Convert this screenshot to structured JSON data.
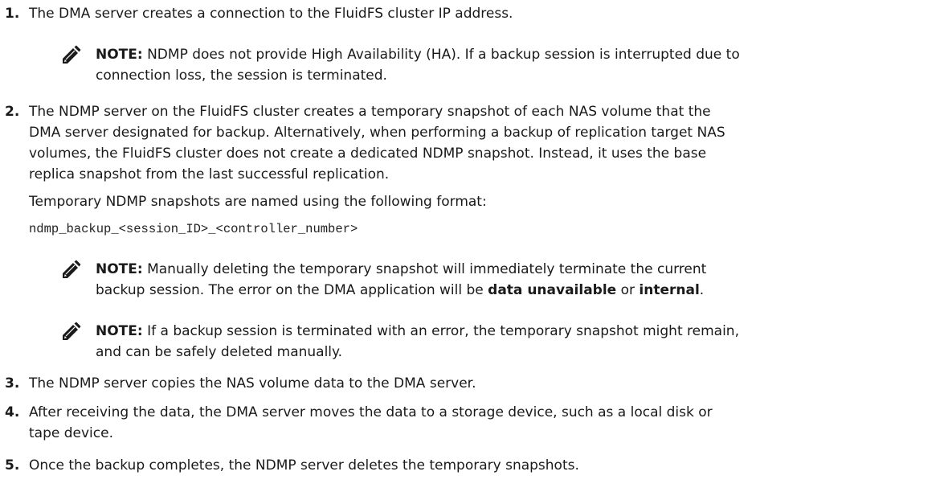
{
  "steps": [
    {
      "num": "1.",
      "text": "The DMA server creates a connection to the FluidFS cluster IP address."
    },
    {
      "num": "2.",
      "text": "The NDMP server on the FluidFS cluster creates a temporary snapshot of each NAS volume that the DMA server designated for backup. Alternatively, when performing a backup of replication target NAS volumes, the FluidFS cluster does not create a dedicated NDMP snapshot. Instead, it uses the base replica snapshot from the last successful replication.",
      "line1": "The NDMP server on the FluidFS cluster creates a temporary snapshot of each NAS volume that the",
      "line2": "DMA server designated for backup. Alternatively, when performing a backup of replication target NAS",
      "line3": "volumes, the FluidFS cluster does not create a dedicated NDMP snapshot. Instead, it uses the base",
      "line4": "replica snapshot from the last successful replication.",
      "format_intro": "Temporary NDMP snapshots are named using the following format:",
      "format_code": "ndmp_backup_<session_ID>_<controller_number>"
    },
    {
      "num": "3.",
      "text": "The NDMP server copies the NAS volume data to the DMA server."
    },
    {
      "num": "4.",
      "text": "After receiving the data, the DMA server moves the data to a storage device, such as a local disk or tape device.",
      "line1": "After receiving the data, the DMA server moves the data to a storage device, such as a local disk or",
      "line2": "tape device."
    },
    {
      "num": "5.",
      "text": "Once the backup completes, the NDMP server deletes the temporary snapshots."
    }
  ],
  "notes": {
    "label": "NOTE:",
    "note1": {
      "line1": " NDMP does not provide High Availability (HA). If a backup session is interrupted due to",
      "line2": "connection loss, the session is terminated."
    },
    "note2": {
      "line1": " Manually deleting the temporary snapshot will immediately terminate the current",
      "line2_pre": "backup session. The error on the DMA application will be ",
      "term1": "data unavailable",
      "mid": " or ",
      "term2": "internal",
      "end": "."
    },
    "note3": {
      "line1": " If a backup session is terminated with an error, the temporary snapshot might remain,",
      "line2": "and can be safely deleted manually."
    }
  },
  "icon": {
    "name": "note-pencil-icon",
    "color": "#1a1a1a"
  }
}
